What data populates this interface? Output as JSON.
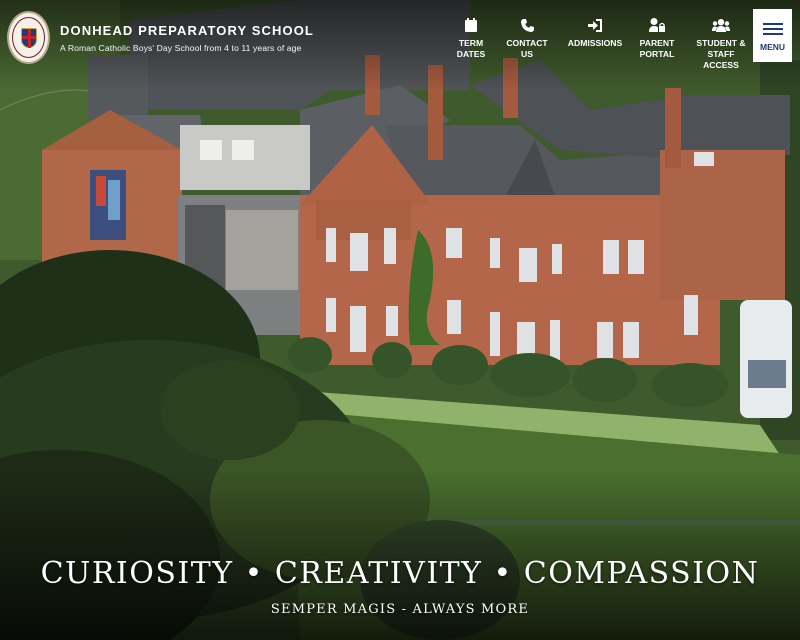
{
  "brand": {
    "school_name": "DONHEAD PREPARATORY SCHOOL",
    "subtitle": "A Roman Catholic Boys' Day School from 4 to 11 years of age",
    "crest_icon": "school-crest-icon"
  },
  "nav": {
    "items": [
      {
        "line1": "TERM",
        "line2": "DATES",
        "icon": "calendar-icon"
      },
      {
        "line1": "CONTACT",
        "line2": "US",
        "icon": "phone-icon"
      },
      {
        "line1": "ADMISSIONS",
        "line2": "",
        "icon": "sign-in-icon"
      },
      {
        "line1": "PARENT",
        "line2": "PORTAL",
        "icon": "user-lock-icon"
      },
      {
        "line1": "STUDENT &",
        "line2": "STAFF ACCESS",
        "icon": "users-icon"
      }
    ],
    "menu_label": "MENU",
    "menu_icon": "hamburger-icon"
  },
  "hero": {
    "tagline": "CURIOSITY • CREATIVITY • COMPASSION",
    "motto": "SEMPER MAGIS - ALWAYS MORE"
  },
  "colors": {
    "brand_navy": "#1e3a78",
    "menu_background": "#ffffff",
    "text": "#ffffff"
  }
}
